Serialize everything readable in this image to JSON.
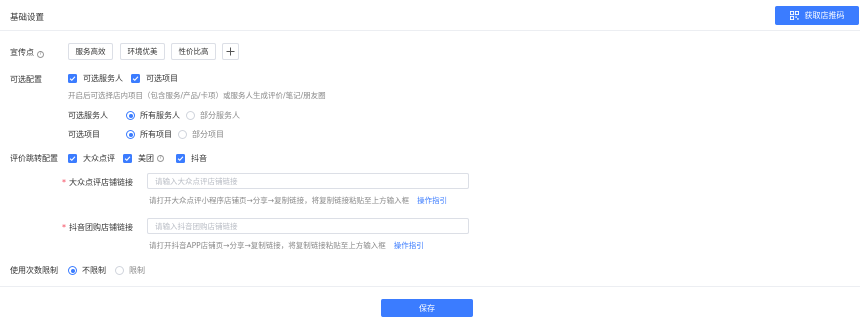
{
  "header": {
    "title": "基础设置",
    "store_code_button": "获取店推码"
  },
  "slogan": {
    "label": "宣传点",
    "tags": [
      "服务高效",
      "环境优美",
      "性价比高"
    ],
    "add_icon": "plus-icon"
  },
  "optional_config": {
    "label": "可选配置",
    "checkboxes": [
      {
        "label": "可选服务人",
        "checked": true
      },
      {
        "label": "可选项目",
        "checked": true
      }
    ],
    "hint": "开启后可选择店内项目（包含服务/产品/卡项）或服务人生成评价/笔记/朋友圈",
    "staff_label": "可选服务人",
    "staff_options": [
      {
        "label": "所有服务人",
        "selected": true
      },
      {
        "label": "部分服务人",
        "selected": false
      }
    ],
    "project_label": "可选项目",
    "project_options": [
      {
        "label": "所有项目",
        "selected": true
      },
      {
        "label": "部分项目",
        "selected": false
      }
    ]
  },
  "review_redirect": {
    "label": "评价跳转配置",
    "platforms": [
      {
        "label": "大众点评",
        "checked": true
      },
      {
        "label": "美团",
        "checked": true
      },
      {
        "label": "抖音",
        "checked": true
      }
    ],
    "dianping": {
      "label": "大众点评店铺链接",
      "placeholder": "请输入大众点评店铺链接",
      "value": "",
      "hint": "请打开大众点评小程序店铺页→分享→复制链接，将复制链接粘贴至上方输入框",
      "link": "操作指引"
    },
    "douyin": {
      "label": "抖音团购店铺链接",
      "placeholder": "请输入抖音团购店铺链接",
      "value": "",
      "hint": "请打开抖音APP店铺页→分享→复制链接，将复制链接粘贴至上方输入框",
      "link": "操作指引"
    }
  },
  "usage_limit": {
    "label": "使用次数限制",
    "options": [
      {
        "label": "不限制",
        "selected": true
      },
      {
        "label": "限制",
        "selected": false
      }
    ]
  },
  "footer": {
    "save_button": "保存"
  },
  "colors": {
    "primary": "#3b7cff",
    "required": "#f5475c",
    "hint": "#888888",
    "border": "#dcdfe6"
  }
}
